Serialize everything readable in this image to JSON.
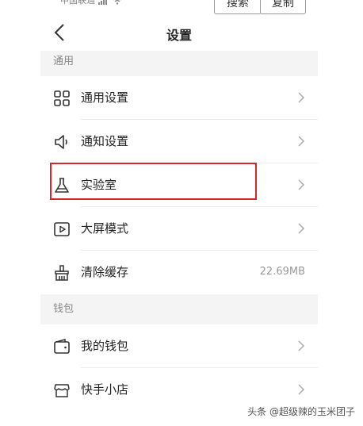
{
  "status_bar": {
    "carrier": "中国联通"
  },
  "top_buttons": {
    "search": "搜索",
    "copy": "复制"
  },
  "header": {
    "title": "设置"
  },
  "sections": [
    {
      "title": "通用",
      "items": [
        {
          "label": "通用设置",
          "icon": "grid-icon"
        },
        {
          "label": "通知设置",
          "icon": "speaker-icon"
        },
        {
          "label": "实验室",
          "icon": "flask-icon"
        },
        {
          "label": "大屏模式",
          "icon": "play-screen-icon"
        },
        {
          "label": "清除缓存",
          "icon": "broom-icon",
          "value": "22.69MB"
        }
      ]
    },
    {
      "title": "钱包",
      "items": [
        {
          "label": "我的钱包",
          "icon": "wallet-icon"
        },
        {
          "label": "快手小店",
          "icon": "shop-icon"
        }
      ]
    }
  ],
  "watermark": "头条 @超级辣的玉米团子",
  "colors": {
    "highlight": "#d6252e",
    "section_bg": "#f4f4f4",
    "divider": "#ececec"
  }
}
